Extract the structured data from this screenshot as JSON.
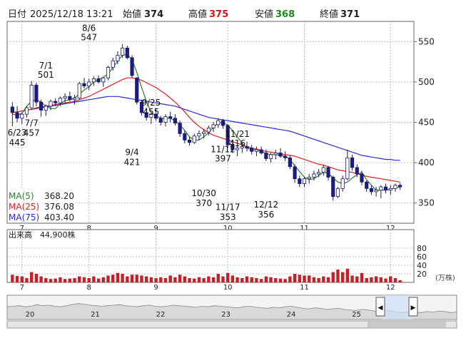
{
  "header": {
    "date_label": "日付",
    "datetime": "2025/12/18 13:21",
    "open_label": "始値",
    "open_value": "374",
    "high_label": "高値",
    "high_value": "375",
    "low_label": "安値",
    "low_value": "368",
    "close_label": "終値",
    "close_value": "371"
  },
  "colors": {
    "up": "#ffffff",
    "down": "#1b1b8c",
    "ma5": "#2f7d2f",
    "ma25": "#e02020",
    "ma75": "#2b2bd6",
    "volume": "#c81e28",
    "high": "#d01818",
    "low": "#1a8a1a"
  },
  "chart_data": [
    {
      "type": "candlestick",
      "ylim": [
        325,
        575
      ],
      "yticks": [
        350,
        400,
        450,
        500,
        550
      ],
      "x_ticks": [
        "7",
        "8",
        "9",
        "10",
        "11",
        "12"
      ],
      "grid": true,
      "legend": [
        {
          "name": "MA(5)",
          "value": "368.20"
        },
        {
          "name": "MA(25)",
          "value": "376.08"
        },
        {
          "name": "MA(75)",
          "value": "403.40"
        }
      ],
      "annotations": [
        {
          "text": "7/1",
          "value": 501
        },
        {
          "text": "8/6",
          "value": 547
        },
        {
          "text": "9/25",
          "value": 455
        },
        {
          "text": "11/12",
          "value": 397
        },
        {
          "text": "11/21",
          "value": 416
        },
        {
          "text": "6/23",
          "value": 445
        },
        {
          "text": "7/7",
          "value": 457
        },
        {
          "text": "9/4",
          "value": 421
        },
        {
          "text": "10/30",
          "value": 370
        },
        {
          "text": "11/17",
          "value": 353
        },
        {
          "text": "12/12",
          "value": 356
        }
      ],
      "candles": [
        [
          469,
          475,
          445,
          462
        ],
        [
          462,
          470,
          450,
          455
        ],
        [
          455,
          462,
          448,
          460
        ],
        [
          460,
          470,
          456,
          468
        ],
        [
          468,
          501,
          466,
          496
        ],
        [
          496,
          499,
          470,
          475
        ],
        [
          475,
          478,
          457,
          465
        ],
        [
          465,
          472,
          458,
          470
        ],
        [
          470,
          478,
          465,
          476
        ],
        [
          476,
          480,
          470,
          474
        ],
        [
          474,
          482,
          470,
          480
        ],
        [
          480,
          486,
          474,
          482
        ],
        [
          482,
          488,
          476,
          478
        ],
        [
          478,
          484,
          472,
          480
        ],
        [
          480,
          500,
          478,
          498
        ],
        [
          498,
          505,
          492,
          495
        ],
        [
          495,
          504,
          490,
          500
        ],
        [
          500,
          507,
          495,
          504
        ],
        [
          504,
          508,
          498,
          500
        ],
        [
          500,
          506,
          494,
          505
        ],
        [
          505,
          520,
          502,
          518
        ],
        [
          518,
          530,
          514,
          526
        ],
        [
          526,
          538,
          522,
          533
        ],
        [
          533,
          547,
          530,
          542
        ],
        [
          542,
          545,
          528,
          530
        ],
        [
          530,
          533,
          505,
          508
        ],
        [
          505,
          506,
          472,
          475
        ],
        [
          475,
          478,
          458,
          462
        ],
        [
          462,
          468,
          452,
          456
        ],
        [
          456,
          462,
          448,
          460
        ],
        [
          460,
          466,
          452,
          455
        ],
        [
          455,
          458,
          446,
          450
        ],
        [
          450,
          460,
          445,
          457
        ],
        [
          457,
          463,
          450,
          455
        ],
        [
          455,
          460,
          446,
          449
        ],
        [
          449,
          452,
          432,
          436
        ],
        [
          436,
          440,
          424,
          428
        ],
        [
          428,
          432,
          421,
          425
        ],
        [
          425,
          436,
          423,
          433
        ],
        [
          433,
          440,
          428,
          436
        ],
        [
          436,
          442,
          430,
          438
        ],
        [
          438,
          446,
          434,
          443
        ],
        [
          443,
          450,
          438,
          447
        ],
        [
          447,
          455,
          443,
          452
        ],
        [
          452,
          454,
          442,
          446
        ],
        [
          446,
          448,
          418,
          422
        ],
        [
          422,
          428,
          412,
          416
        ],
        [
          416,
          422,
          408,
          418
        ],
        [
          418,
          425,
          412,
          420
        ],
        [
          420,
          426,
          414,
          418
        ],
        [
          418,
          422,
          410,
          414
        ],
        [
          414,
          420,
          408,
          416
        ],
        [
          416,
          420,
          410,
          412
        ],
        [
          412,
          416,
          402,
          405
        ],
        [
          405,
          412,
          400,
          410
        ],
        [
          410,
          416,
          404,
          412
        ],
        [
          412,
          418,
          406,
          408
        ],
        [
          408,
          414,
          402,
          406
        ],
        [
          406,
          409,
          392,
          395
        ],
        [
          395,
          398,
          375,
          380
        ],
        [
          380,
          384,
          370,
          374
        ],
        [
          374,
          382,
          370,
          380
        ],
        [
          380,
          386,
          374,
          382
        ],
        [
          382,
          390,
          378,
          386
        ],
        [
          386,
          392,
          382,
          388
        ],
        [
          388,
          397,
          384,
          394
        ],
        [
          394,
          396,
          378,
          382
        ],
        [
          382,
          384,
          353,
          358
        ],
        [
          358,
          370,
          356,
          368
        ],
        [
          368,
          384,
          364,
          380
        ],
        [
          380,
          416,
          378,
          406
        ],
        [
          406,
          410,
          390,
          394
        ],
        [
          394,
          398,
          382,
          386
        ],
        [
          386,
          390,
          372,
          376
        ],
        [
          376,
          378,
          364,
          368
        ],
        [
          368,
          372,
          360,
          364
        ],
        [
          364,
          370,
          358,
          366
        ],
        [
          366,
          372,
          356,
          370
        ],
        [
          370,
          374,
          362,
          366
        ],
        [
          366,
          372,
          360,
          368
        ],
        [
          368,
          374,
          364,
          372
        ],
        [
          372,
          375,
          366,
          370
        ]
      ],
      "ma5": [
        460,
        459,
        461,
        470,
        476,
        478,
        475,
        470,
        467,
        467,
        473,
        477,
        478,
        480,
        485,
        490,
        494,
        500,
        503,
        506,
        510,
        518,
        526,
        533,
        534,
        528,
        512,
        493,
        476,
        462,
        458,
        455,
        455,
        455,
        452,
        447,
        440,
        432,
        428,
        428,
        432,
        437,
        444,
        449,
        450,
        446,
        440,
        432,
        424,
        418,
        416,
        416,
        414,
        411,
        410,
        410,
        409,
        408,
        404,
        396,
        389,
        382,
        379,
        380,
        384,
        388,
        387,
        381,
        376,
        374,
        376,
        381,
        385,
        388,
        379,
        372,
        366,
        366,
        366,
        367,
        369,
        370
      ],
      "ma25": [
        462,
        463,
        464,
        465,
        466,
        468,
        469,
        470,
        471,
        472,
        473,
        474,
        475,
        476,
        478,
        480,
        482,
        485,
        488,
        491,
        494,
        497,
        500,
        503,
        505,
        505,
        504,
        502,
        499,
        496,
        493,
        489,
        485,
        480,
        475,
        469,
        463,
        456,
        450,
        445,
        441,
        437,
        434,
        432,
        430,
        428,
        426,
        424,
        422,
        420,
        418,
        417,
        415,
        414,
        413,
        412,
        411,
        410,
        409,
        408,
        406,
        404,
        402,
        400,
        398,
        397,
        395,
        393,
        391,
        390,
        389,
        388,
        386,
        385,
        383,
        382,
        381,
        380,
        379,
        378,
        377,
        376
      ],
      "ma75": [
        462,
        463,
        464,
        465,
        466,
        467,
        468,
        469,
        470,
        471,
        472,
        473,
        474,
        475,
        476,
        477,
        478,
        479,
        480,
        481,
        482,
        482,
        482,
        481,
        480,
        479,
        478,
        477,
        476,
        475,
        474,
        473,
        472,
        471,
        470,
        468,
        466,
        464,
        462,
        460,
        458,
        456,
        455,
        454,
        453,
        452,
        451,
        450,
        449,
        448,
        447,
        446,
        445,
        444,
        443,
        442,
        441,
        440,
        439,
        437,
        435,
        433,
        431,
        429,
        427,
        425,
        423,
        421,
        419,
        417,
        415,
        413,
        411,
        409,
        408,
        407,
        406,
        405,
        404,
        404,
        403,
        403
      ]
    },
    {
      "type": "bar",
      "title": "出来高",
      "current_label": "44,900株",
      "unit": "(万株)",
      "ylim": [
        0,
        100
      ],
      "yticks": [
        20,
        40,
        60,
        80
      ],
      "values": [
        18,
        15,
        14,
        10,
        24,
        20,
        14,
        10,
        8,
        9,
        12,
        8,
        9,
        10,
        14,
        12,
        10,
        14,
        9,
        12,
        16,
        18,
        22,
        20,
        14,
        18,
        18,
        16,
        14,
        12,
        10,
        12,
        10,
        16,
        12,
        18,
        14,
        10,
        9,
        12,
        10,
        14,
        12,
        20,
        14,
        22,
        16,
        12,
        10,
        14,
        12,
        10,
        8,
        14,
        12,
        10,
        9,
        8,
        14,
        20,
        18,
        16,
        16,
        12,
        10,
        14,
        12,
        24,
        30,
        24,
        32,
        16,
        14,
        22,
        10,
        12,
        14,
        12,
        9,
        14,
        10,
        5
      ]
    },
    {
      "type": "area",
      "x_ticks": [
        "20",
        "21",
        "22",
        "23",
        "24",
        "25"
      ],
      "values": [
        44,
        45,
        46,
        44,
        45,
        48,
        46,
        47,
        45,
        44,
        46,
        48,
        50,
        49,
        47,
        46,
        45,
        46,
        47,
        48,
        46,
        45,
        44,
        46,
        47,
        45,
        44,
        45,
        47,
        46,
        45,
        44,
        43,
        45,
        44,
        46,
        45,
        44,
        43,
        42,
        44,
        45,
        43,
        42,
        41,
        43,
        42,
        44,
        45,
        43,
        41,
        40,
        42,
        41,
        39,
        40,
        41,
        39,
        38,
        37,
        39,
        38,
        36,
        35,
        37,
        36,
        34,
        33,
        35,
        34,
        33,
        35,
        34,
        36,
        35,
        33,
        34
      ]
    }
  ]
}
